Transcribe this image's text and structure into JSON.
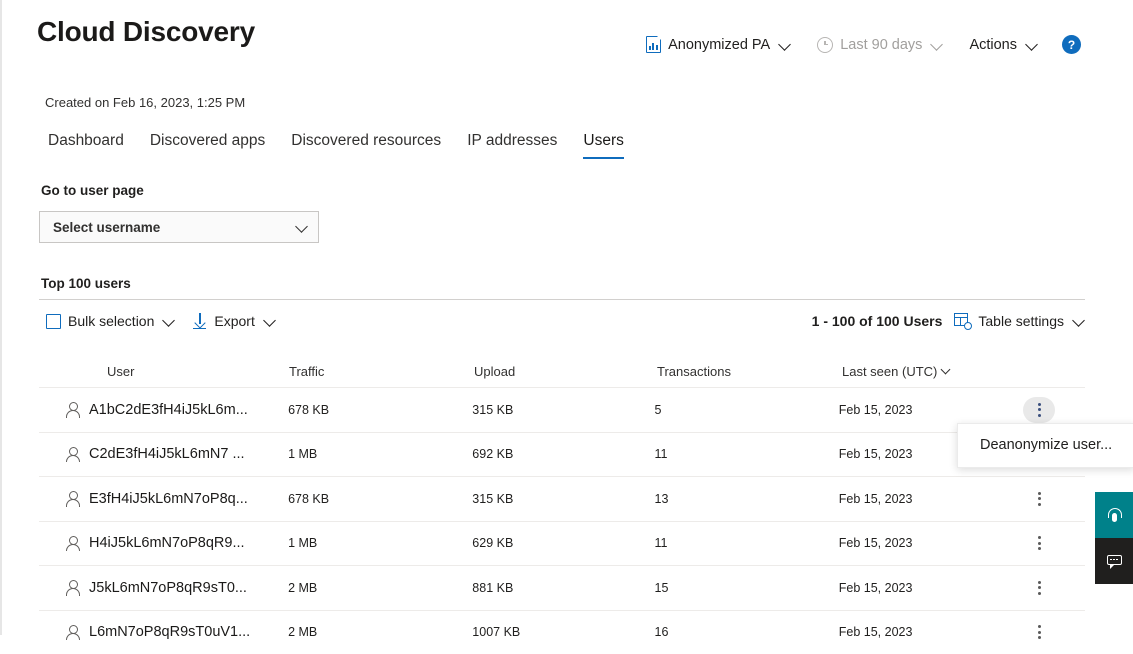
{
  "header": {
    "title": "Cloud Discovery",
    "report_selector": "Anonymized PA",
    "date_range": "Last 90 days",
    "actions": "Actions",
    "help": "?"
  },
  "created_on": "Created on Feb 16, 2023, 1:25 PM",
  "tabs": [
    {
      "label": "Dashboard",
      "active": false
    },
    {
      "label": "Discovered apps",
      "active": false
    },
    {
      "label": "Discovered resources",
      "active": false
    },
    {
      "label": "IP addresses",
      "active": false
    },
    {
      "label": "Users",
      "active": true
    }
  ],
  "user_page": {
    "label": "Go to user page",
    "select_value": "Select username"
  },
  "section": {
    "title": "Top 100 users"
  },
  "toolbar": {
    "bulk_selection": "Bulk selection",
    "export": "Export",
    "count": "1 - 100 of 100 Users",
    "table_settings": "Table settings"
  },
  "table": {
    "columns": [
      "User",
      "Traffic",
      "Upload",
      "Transactions",
      "Last seen (UTC)"
    ],
    "sorted_column": "Last seen (UTC)",
    "rows": [
      {
        "user": "A1bC2dE3fH4iJ5kL6m...",
        "traffic": "678 KB",
        "upload": "315 KB",
        "transactions": "5",
        "last_seen": "Feb 15, 2023"
      },
      {
        "user": "C2dE3fH4iJ5kL6mN7 ...",
        "traffic": "1 MB",
        "upload": "692 KB",
        "transactions": "11",
        "last_seen": "Feb 15, 2023"
      },
      {
        "user": "E3fH4iJ5kL6mN7oP8q...",
        "traffic": "678 KB",
        "upload": "315 KB",
        "transactions": "13",
        "last_seen": "Feb 15, 2023"
      },
      {
        "user": "H4iJ5kL6mN7oP8qR9...",
        "traffic": "1 MB",
        "upload": "629 KB",
        "transactions": "11",
        "last_seen": "Feb 15, 2023"
      },
      {
        "user": "J5kL6mN7oP8qR9sT0...",
        "traffic": "2 MB",
        "upload": "881 KB",
        "transactions": "15",
        "last_seen": "Feb 15, 2023"
      },
      {
        "user": "L6mN7oP8qR9sT0uV1...",
        "traffic": "2 MB",
        "upload": "1007 KB",
        "transactions": "16",
        "last_seen": "Feb 15, 2023"
      }
    ]
  },
  "context_menu": {
    "items": [
      "Deanonymize user..."
    ]
  },
  "colors": {
    "accent": "#0f6cbd",
    "support_widget": "#00818a",
    "feedback_widget": "#201f1e",
    "divider": "#d2d0ce",
    "row_divider": "#edebe9"
  }
}
